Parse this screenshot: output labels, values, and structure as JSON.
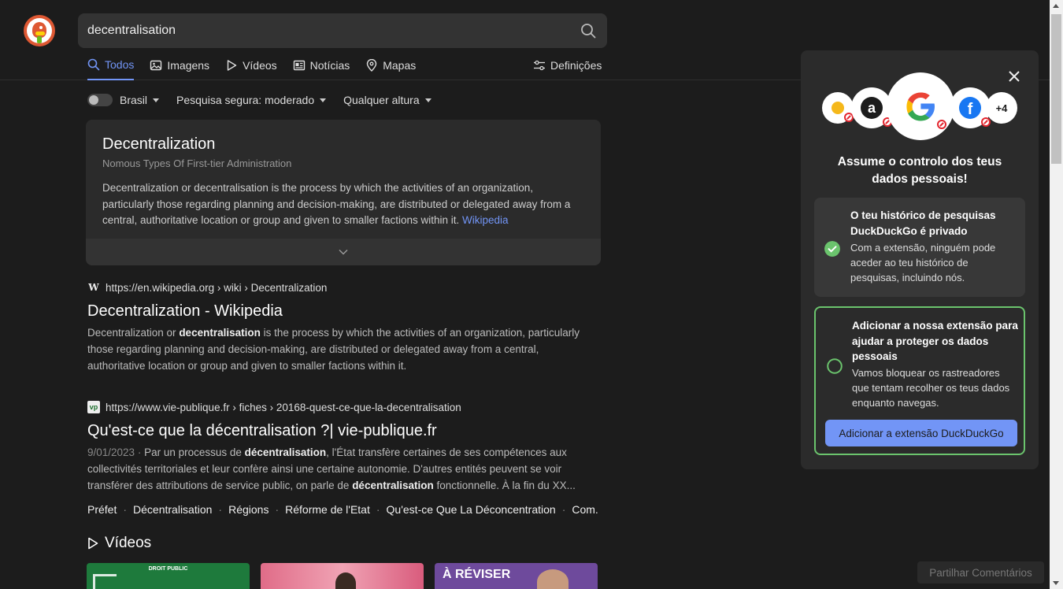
{
  "search": {
    "query": "decentralisation"
  },
  "nav": {
    "tabs": [
      {
        "label": "Todos",
        "icon": "search-icon",
        "active": true
      },
      {
        "label": "Imagens",
        "icon": "image-icon"
      },
      {
        "label": "Vídeos",
        "icon": "play-icon"
      },
      {
        "label": "Notícias",
        "icon": "news-icon"
      },
      {
        "label": "Mapas",
        "icon": "map-pin-icon"
      }
    ],
    "settings_label": "Definições"
  },
  "filters": {
    "region": "Brasil",
    "safe_search": "Pesquisa segura: moderado",
    "time": "Qualquer altura"
  },
  "about": {
    "title": "Decentralization",
    "subtitle": "Nomous Types Of First-tier Administration",
    "text": "Decentralization or decentralisation is the process by which the activities of an organization, particularly those regarding planning and decision-making, are distributed or delegated away from a central, authoritative location or group and given to smaller factions within it.",
    "source": "Wikipedia"
  },
  "results": [
    {
      "url": "https://en.wikipedia.org › wiki › Decentralization",
      "favicon": "W",
      "title": "Decentralization - Wikipedia",
      "snippet_parts": [
        "Decentralization or ",
        "decentralisation",
        " is the process by which the activities of an organization, particularly those regarding planning and decision-making, are distributed or delegated away from a central, authoritative location or group and given to smaller factions within it."
      ]
    },
    {
      "url": "https://www.vie-publique.fr › fiches › 20168-quest-ce-que-la-decentralisation",
      "favicon": "vp",
      "title": "Qu'est-ce que la décentralisation ?| vie-publique.fr",
      "date": "9/01/2023",
      "snippet_parts": [
        "Par un processus de ",
        "décentralisation",
        ", l'État transfère certaines de ses compétences aux collectivités territoriales et leur confère ainsi une certaine autonomie. D'autres entités peuvent se voir transférer des attributions de service public, on parle de ",
        "décentralisation",
        " fonctionnelle. À la fin du XX..."
      ],
      "sitelinks": [
        "Préfet",
        "Décentralisation",
        "Régions",
        "Réforme de l'Etat",
        "Qu'est-ce Que La Déconcentration",
        "Com..."
      ]
    }
  ],
  "videos": {
    "heading": "Vídeos",
    "thumb_texts": [
      "DROIT PUBLIC",
      "À RÉVISER"
    ]
  },
  "popup": {
    "brands": [
      {
        "name": "bing-icon"
      },
      {
        "name": "amazon-icon"
      },
      {
        "name": "google-icon"
      },
      {
        "name": "facebook-icon"
      },
      {
        "name": "more-count",
        "label": "+4"
      }
    ],
    "title": "Assume o controlo dos teus dados pessoais!",
    "card1": {
      "title": "O teu histórico de pesquisas DuckDuckGo é privado",
      "text": "Com a extensão, ninguém pode aceder ao teu histórico de pesquisas, incluindo nós."
    },
    "card2": {
      "title": "Adicionar a nossa extensão para ajudar a proteger os dados pessoais",
      "text": "Vamos bloquear os rastreadores que tentam recolher os teus dados enquanto navegas.",
      "button": "Adicionar a extensão DuckDuckGo"
    }
  },
  "feedback_label": "Partilhar Comentários",
  "colors": {
    "accent": "#7295f6",
    "success": "#6bc46d",
    "brand": "#de5833"
  }
}
